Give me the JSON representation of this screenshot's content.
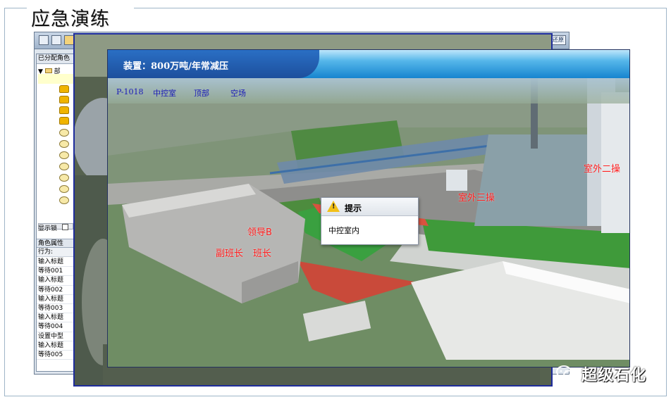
{
  "slide": {
    "title": "应急演练"
  },
  "back_window": {
    "right_button_label": "还原",
    "role_panel": {
      "header": "已分配角色",
      "tree_root": "部",
      "show_lock_label": "显示锁",
      "attr_header": "角色属性",
      "attr_subheader": "行为:",
      "attr_rows": [
        "输入标题",
        "等待001",
        "输入标题",
        "等待002",
        "输入标题",
        "等待003",
        "输入标题",
        "等待004",
        "设置中型",
        "输入标题",
        "等待005"
      ]
    }
  },
  "front_window": {
    "device_label": "装置：800万吨/年常减压",
    "nav": [
      "P-1018",
      "中控室",
      "顶部",
      "空场"
    ],
    "scene_labels": [
      "领导B",
      "副班长",
      "班长",
      "室外二操",
      "室外三操"
    ]
  },
  "dialog": {
    "title": "提示",
    "message": "中控室内",
    "icon": "warning-icon"
  },
  "watermark": {
    "text": "超级石化",
    "icon": "wechat-icon"
  },
  "colors": {
    "window_border": "#1e2c9c",
    "header_blue": "#1684cf",
    "label_red": "#ff2020",
    "nav_link": "#1a1ab8"
  }
}
